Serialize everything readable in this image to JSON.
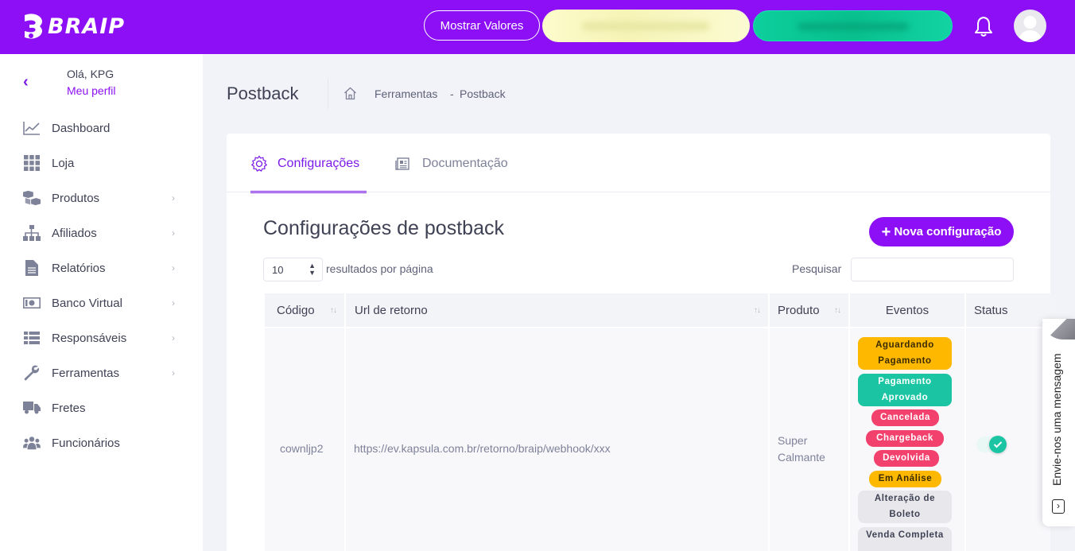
{
  "app": {
    "brand": "BRAIP"
  },
  "topbar": {
    "show_values_label": "Mostrar Valores"
  },
  "sidebar": {
    "greeting": "Olá, KPG",
    "profile_link": "Meu perfil",
    "items": [
      {
        "label": "Dashboard",
        "icon": "chart-line-icon",
        "has_children": false
      },
      {
        "label": "Loja",
        "icon": "grid-icon",
        "has_children": false
      },
      {
        "label": "Produtos",
        "icon": "boxes-icon",
        "has_children": true
      },
      {
        "label": "Afiliados",
        "icon": "sitemap-icon",
        "has_children": true
      },
      {
        "label": "Relatórios",
        "icon": "file-icon",
        "has_children": true
      },
      {
        "label": "Banco Virtual",
        "icon": "money-bill-icon",
        "has_children": true
      },
      {
        "label": "Responsáveis",
        "icon": "list-icon",
        "has_children": true
      },
      {
        "label": "Ferramentas",
        "icon": "wrench-icon",
        "has_children": true
      },
      {
        "label": "Fretes",
        "icon": "truck-icon",
        "has_children": false
      },
      {
        "label": "Funcionários",
        "icon": "users-icon",
        "has_children": false
      }
    ],
    "chevron": "›"
  },
  "header": {
    "title": "Postback",
    "breadcrumb": [
      "Ferramentas",
      "-",
      "Postback"
    ]
  },
  "tabs": [
    {
      "label": "Configurações",
      "active": true,
      "icon": "gear-icon"
    },
    {
      "label": "Documentação",
      "active": false,
      "icon": "document-icon"
    }
  ],
  "section": {
    "title": "Configurações de postback",
    "new_button": "Nova configuração",
    "page_size": "10",
    "results_per_page": "resultados por página",
    "search_label": "Pesquisar",
    "search_value": ""
  },
  "table": {
    "columns": [
      "Código",
      "Url de retorno",
      "Produto",
      "Eventos",
      "Status"
    ],
    "rows": [
      {
        "code": "cownljp2",
        "url": "https://ev.kapsula.com.br/retorno/braip/webhook/xxx",
        "product_line1": "Super",
        "product_line2": "Calmante",
        "events": [
          {
            "label": "Aguardando Pagamento",
            "color": "#ffb800"
          },
          {
            "label": "Pagamento Aprovado",
            "color": "#1bc5a4"
          },
          {
            "label": "Cancelada",
            "color": "#f1416c"
          },
          {
            "label": "Chargeback",
            "color": "#f1416c"
          },
          {
            "label": "Devolvida",
            "color": "#f1416c"
          },
          {
            "label": "Em Análise",
            "color": "#ffb800"
          },
          {
            "label": "Alteração de Boleto",
            "color": "#e8e8ec"
          },
          {
            "label": "Venda Completa",
            "color": "#e8e8ec"
          }
        ],
        "status_active": true
      }
    ]
  },
  "feedback": {
    "label": "Envie-nos uma mensagem"
  },
  "colors": {
    "brand": "#8c0ff5",
    "accent": "#7b19e8",
    "success": "#1bc5a4",
    "danger": "#f1416c",
    "warning": "#ffb800"
  }
}
